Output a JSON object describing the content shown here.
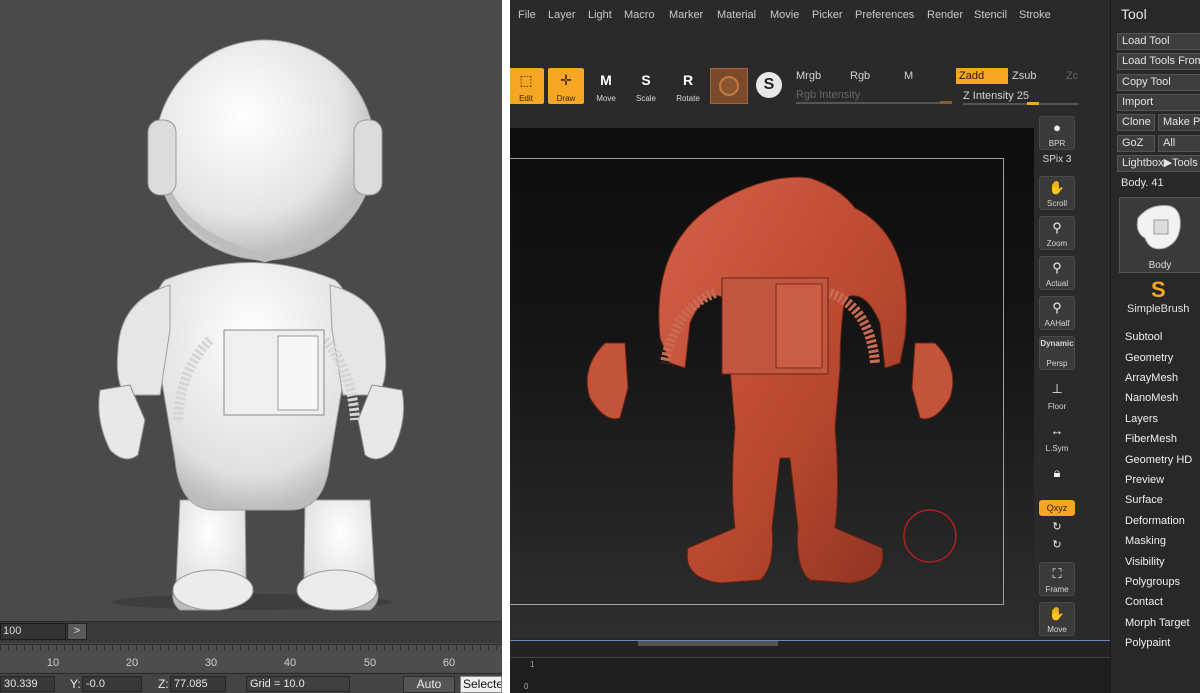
{
  "left_viewport": {
    "frame_field": "100",
    "next_frame_label": ">",
    "ruler_labels": [
      "10",
      "20",
      "30",
      "40",
      "50",
      "60"
    ],
    "status": {
      "x_value": "30.339",
      "y_label": "Y:",
      "y_value": "-0.0",
      "z_label": "Z:",
      "z_value": "77.085",
      "grid": "Grid = 10.0",
      "auto_label": "Auto",
      "select_label": "Selecte"
    }
  },
  "zbrush": {
    "menus": [
      "File",
      "Layer",
      "Light",
      "Macro",
      "Marker",
      "Material",
      "Movie",
      "Picker",
      "Preferences",
      "Render",
      "Stencil",
      "Stroke"
    ],
    "shelf": {
      "edit": "Edit",
      "draw": "Draw",
      "move": "Move",
      "scale": "Scale",
      "rotate": "Rotate",
      "mrgb": "Mrgb",
      "rgb": "Rgb",
      "m": "M",
      "zadd": "Zadd",
      "zsub": "Zsub",
      "zc": "Zc",
      "rgb_intensity": "Rgb Intensity",
      "z_intensity": "Z Intensity 25",
      "z_intensity_value": 25
    },
    "right_shelf": {
      "bpr": "BPR",
      "spix": "SPix 3",
      "scroll": "Scroll",
      "zoom": "Zoom",
      "actual": "Actual",
      "aahalf": "AAHalf",
      "dynamic": "Dynamic",
      "persp": "Persp",
      "floor": "Floor",
      "lsym": "L.Sym",
      "xyz": "Qxyz",
      "frame": "Frame",
      "move": "Move"
    },
    "tray_labels": [
      "1",
      "0"
    ],
    "tool_panel": {
      "title": "Tool",
      "load_tool": "Load Tool",
      "load_tools_from": "Load Tools From",
      "copy_tool": "Copy Tool",
      "import": "Import",
      "clone": "Clone",
      "make": "Make P",
      "goz": "GoZ",
      "all": "All",
      "lightbox": "Lightbox▶Tools",
      "body_count": "Body. 41",
      "thumb_label": "Body",
      "simplebrush": "SimpleBrush",
      "menu_items": [
        "Subtool",
        "Geometry",
        "ArrayMesh",
        "NanoMesh",
        "Layers",
        "FiberMesh",
        "Geometry HD",
        "Preview",
        "Surface",
        "Deformation",
        "Masking",
        "Visibility",
        "Polygroups",
        "Contact",
        "Morph Target",
        "Polypaint"
      ]
    }
  },
  "colors": {
    "accent": "#f5a623",
    "model_red": "#b8472f",
    "model_white": "#e6e6e6"
  }
}
